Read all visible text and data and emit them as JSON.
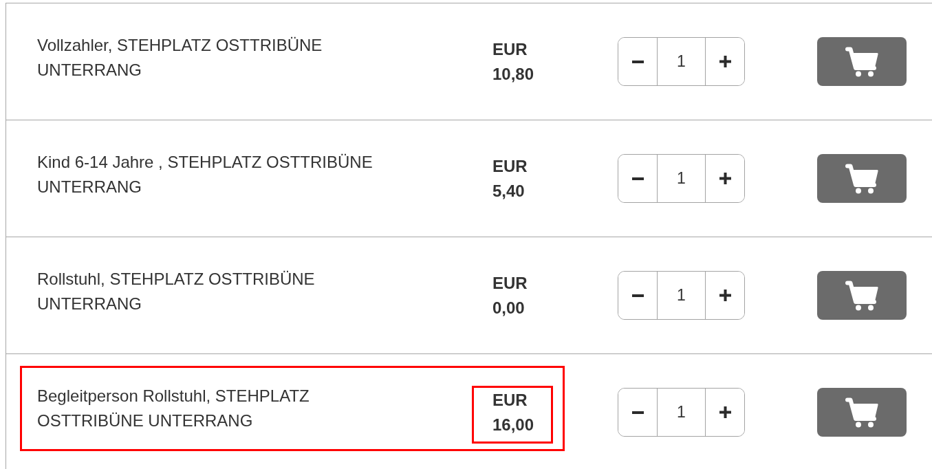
{
  "items": [
    {
      "description": "Vollzahler, STEHPLATZ OSTTRIBÜNE UNTERRANG",
      "price": "EUR 10,80",
      "quantity": "1",
      "highlighted": false,
      "price_highlighted": false
    },
    {
      "description": "Kind 6-14 Jahre , STEHPLATZ OSTTRIBÜNE UNTERRANG",
      "price": "EUR 5,40",
      "quantity": "1",
      "highlighted": false,
      "price_highlighted": false
    },
    {
      "description": "Rollstuhl, STEHPLATZ OSTTRIBÜNE UNTERRANG",
      "price": "EUR 0,00",
      "quantity": "1",
      "highlighted": false,
      "price_highlighted": false
    },
    {
      "description": "Begleitperson Rollstuhl, STEHPLATZ OSTTRIBÜNE UNTERRANG",
      "price": "EUR 16,00",
      "quantity": "1",
      "highlighted": true,
      "price_highlighted": true
    }
  ]
}
